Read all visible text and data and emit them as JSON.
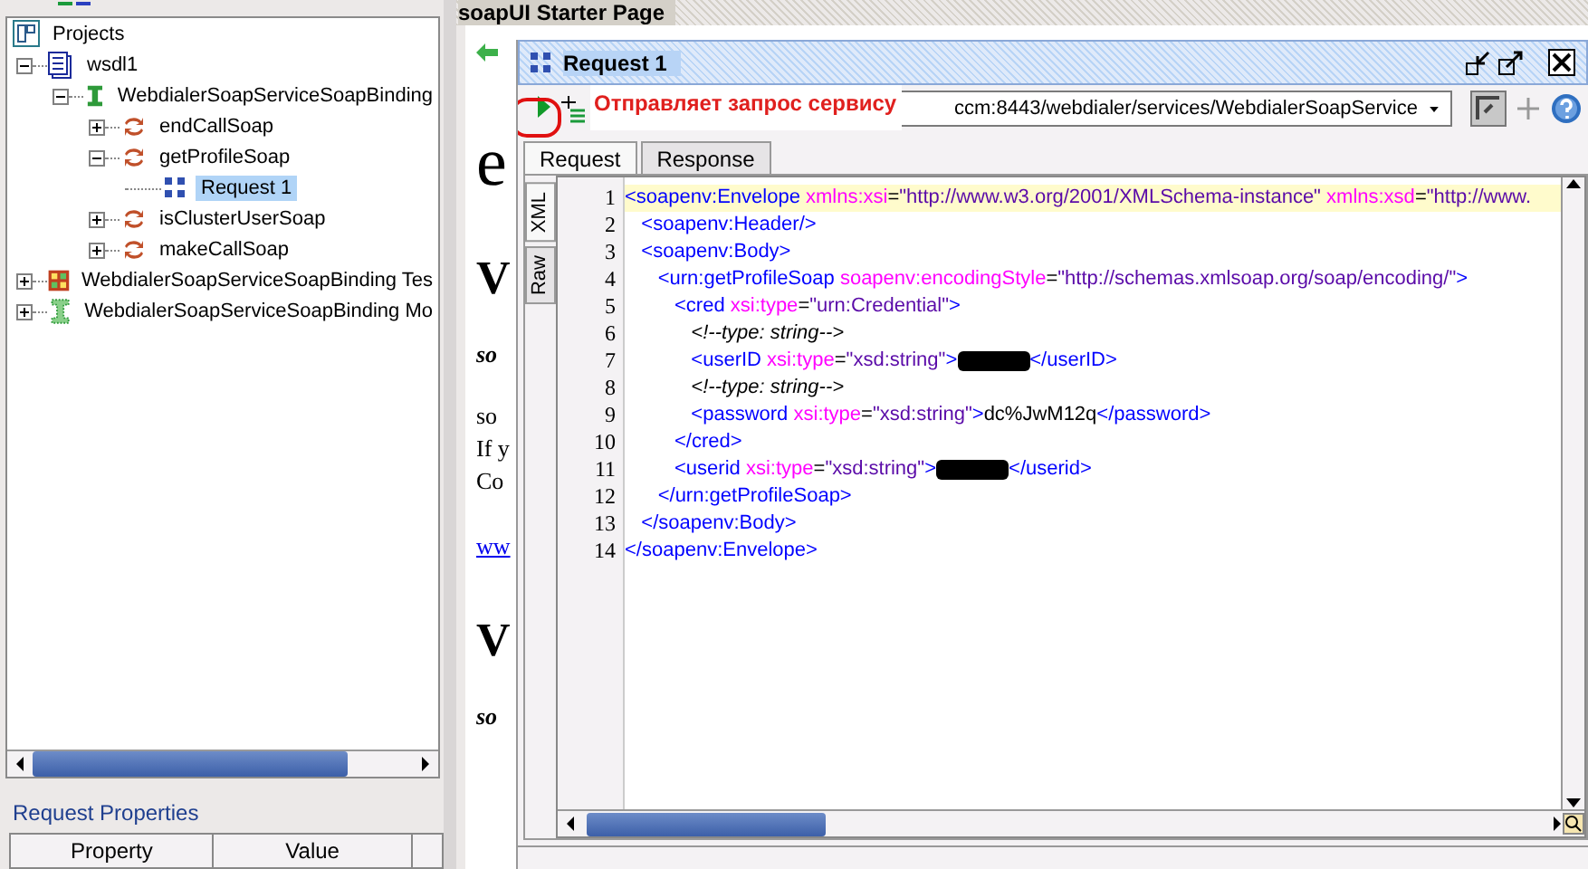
{
  "tree": {
    "label": "Projects",
    "selected": false,
    "children": [
      {
        "label": "wsdl1",
        "kind": "wsdl",
        "expanded": true,
        "selected": false,
        "children": [
          {
            "label": "WebdialerSoapServiceSoapBinding",
            "kind": "interface",
            "expanded": true,
            "selected": false,
            "children": [
              {
                "label": "endCallSoap",
                "kind": "operation",
                "expanded": false,
                "selected": false
              },
              {
                "label": "getProfileSoap",
                "kind": "operation",
                "expanded": true,
                "selected": false,
                "children": [
                  {
                    "label": "Request 1",
                    "kind": "request",
                    "selected": true
                  }
                ]
              },
              {
                "label": "isClusterUserSoap",
                "kind": "operation",
                "expanded": false,
                "selected": false
              },
              {
                "label": "makeCallSoap",
                "kind": "operation",
                "expanded": false,
                "selected": false
              }
            ]
          }
        ]
      },
      {
        "label": "WebdialerSoapServiceSoapBinding Tes",
        "kind": "testsuite",
        "expanded": false,
        "selected": false
      },
      {
        "label": "WebdialerSoapServiceSoapBinding Mo",
        "kind": "mock",
        "expanded": false,
        "selected": false
      }
    ]
  },
  "properties": {
    "title": "Request Properties",
    "columns": [
      "Property",
      "Value"
    ]
  },
  "starter": {
    "title": "soapUI Starter Page",
    "fragments": [
      {
        "kind": "big",
        "text": "e"
      },
      {
        "kind": "heading",
        "text": "V"
      },
      {
        "kind": "sub",
        "text": "so"
      },
      {
        "kind": "plain",
        "text": "so"
      },
      {
        "kind": "plain",
        "text": "If y"
      },
      {
        "kind": "plain",
        "text": "Co"
      },
      {
        "kind": "link",
        "text": "ww"
      },
      {
        "kind": "heading",
        "text": "V"
      },
      {
        "kind": "sub",
        "text": "so"
      }
    ]
  },
  "request": {
    "title": "Request 1",
    "tooltip": "Отправляет запрос сервису",
    "endpoint": "ccm:8443/webdialer/services/WebdialerSoapService",
    "tabs": [
      {
        "label": "Request",
        "selected": true
      },
      {
        "label": "Response",
        "selected": false
      }
    ],
    "side_tabs": [
      {
        "label": "XML",
        "selected": true
      },
      {
        "label": "Raw",
        "selected": false
      }
    ],
    "lines": [
      {
        "number": "1",
        "highlighted": true,
        "tokens": [
          {
            "kind": "tag",
            "text": "<soapenv:Envelope"
          },
          {
            "kind": "attr",
            "text": " xmlns:xsi"
          },
          {
            "kind": "text",
            "text": "="
          },
          {
            "kind": "value",
            "text": "\"http://www.w3.org/2001/XMLSchema-instance\""
          },
          {
            "kind": "attr",
            "text": " xmlns:xsd"
          },
          {
            "kind": "text",
            "text": "="
          },
          {
            "kind": "value",
            "text": "\"http://www."
          }
        ]
      },
      {
        "number": "2",
        "highlighted": false,
        "tokens": [
          {
            "kind": "tag",
            "text": "   <soapenv:Header/>"
          }
        ]
      },
      {
        "number": "3",
        "highlighted": false,
        "tokens": [
          {
            "kind": "tag",
            "text": "   <soapenv:Body>"
          }
        ]
      },
      {
        "number": "4",
        "highlighted": false,
        "tokens": [
          {
            "kind": "tag",
            "text": "      <urn:getProfileSoap"
          },
          {
            "kind": "attr",
            "text": " soapenv:encodingStyle"
          },
          {
            "kind": "text",
            "text": "="
          },
          {
            "kind": "value",
            "text": "\"http://schemas.xmlsoap.org/soap/encoding/\""
          },
          {
            "kind": "tag",
            "text": ">"
          }
        ]
      },
      {
        "number": "5",
        "highlighted": false,
        "tokens": [
          {
            "kind": "tag",
            "text": "         <cred"
          },
          {
            "kind": "attr",
            "text": " xsi:type"
          },
          {
            "kind": "text",
            "text": "="
          },
          {
            "kind": "value",
            "text": "\"urn:Credential\""
          },
          {
            "kind": "tag",
            "text": ">"
          }
        ]
      },
      {
        "number": "6",
        "highlighted": false,
        "tokens": [
          {
            "kind": "comment",
            "text": "            <!--type: string-->"
          }
        ]
      },
      {
        "number": "7",
        "highlighted": false,
        "tokens": [
          {
            "kind": "tag",
            "text": "            <userID"
          },
          {
            "kind": "attr",
            "text": " xsi:type"
          },
          {
            "kind": "text",
            "text": "="
          },
          {
            "kind": "value",
            "text": "\"xsd:string\""
          },
          {
            "kind": "tag",
            "text": ">"
          },
          {
            "kind": "redacted"
          },
          {
            "kind": "tag",
            "text": "</userID>"
          }
        ]
      },
      {
        "number": "8",
        "highlighted": false,
        "tokens": [
          {
            "kind": "comment",
            "text": "            <!--type: string-->"
          }
        ]
      },
      {
        "number": "9",
        "highlighted": false,
        "tokens": [
          {
            "kind": "tag",
            "text": "            <password"
          },
          {
            "kind": "attr",
            "text": " xsi:type"
          },
          {
            "kind": "text",
            "text": "="
          },
          {
            "kind": "value",
            "text": "\"xsd:string\""
          },
          {
            "kind": "tag",
            "text": ">"
          },
          {
            "kind": "text",
            "text": "dc%JwM12q"
          },
          {
            "kind": "tag",
            "text": "</password>"
          }
        ]
      },
      {
        "number": "10",
        "highlighted": false,
        "tokens": [
          {
            "kind": "tag",
            "text": "         </cred>"
          }
        ]
      },
      {
        "number": "11",
        "highlighted": false,
        "tokens": [
          {
            "kind": "tag",
            "text": "         <userid"
          },
          {
            "kind": "attr",
            "text": " xsi:type"
          },
          {
            "kind": "text",
            "text": "="
          },
          {
            "kind": "value",
            "text": "\"xsd:string\""
          },
          {
            "kind": "tag",
            "text": ">"
          },
          {
            "kind": "redacted"
          },
          {
            "kind": "tag",
            "text": "</userid>"
          }
        ]
      },
      {
        "number": "12",
        "highlighted": false,
        "tokens": [
          {
            "kind": "tag",
            "text": "      </urn:getProfileSoap>"
          }
        ]
      },
      {
        "number": "13",
        "highlighted": false,
        "tokens": [
          {
            "kind": "tag",
            "text": "   </soapenv:Body>"
          }
        ]
      },
      {
        "number": "14",
        "highlighted": false,
        "tokens": [
          {
            "kind": "tag",
            "text": "</soapenv:Envelope>"
          }
        ]
      }
    ]
  }
}
